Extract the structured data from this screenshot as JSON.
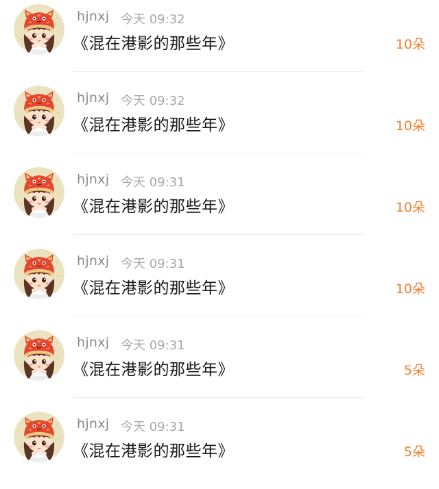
{
  "gifts": [
    {
      "user": "hjnxj",
      "time": "今天 09:32",
      "title": "《混在港影的那些年》",
      "amount": "10朵"
    },
    {
      "user": "hjnxj",
      "time": "今天 09:32",
      "title": "《混在港影的那些年》",
      "amount": "10朵"
    },
    {
      "user": "hjnxj",
      "time": "今天 09:31",
      "title": "《混在港影的那些年》",
      "amount": "10朵"
    },
    {
      "user": "hjnxj",
      "time": "今天 09:31",
      "title": "《混在港影的那些年》",
      "amount": "10朵"
    },
    {
      "user": "hjnxj",
      "time": "今天 09:31",
      "title": "《混在港影的那些年》",
      "amount": "5朵"
    },
    {
      "user": "hjnxj",
      "time": "今天 09:31",
      "title": "《混在港影的那些年》",
      "amount": "5朵"
    }
  ],
  "colors": {
    "amount": "#f07f2c",
    "username": "#8a8a8a",
    "time": "#a8a8a8",
    "title": "#1a1a1a",
    "divider": "#eeeeee"
  },
  "icons": {
    "avatar": "avatar-girl-tiger-hat-icon"
  }
}
